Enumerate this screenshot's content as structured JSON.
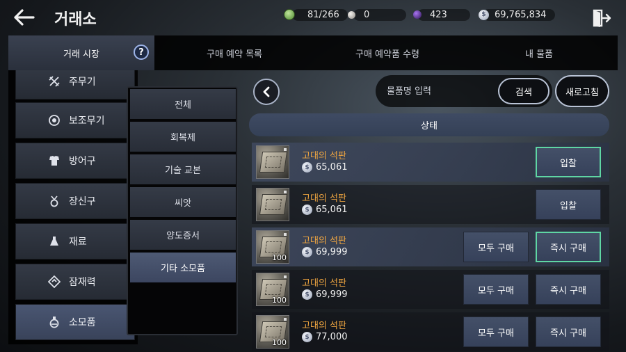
{
  "header": {
    "title": "거래소",
    "resources": [
      {
        "icon": "green-gem-icon",
        "value": "81/266",
        "color": "#7bb85a"
      },
      {
        "icon": "silver-pearl-icon",
        "value": "0",
        "color": "#c9c6c2"
      },
      {
        "icon": "purple-orb-icon",
        "value": "423",
        "color": "#6a3fb0"
      },
      {
        "icon": "silver-coin-icon",
        "value": "69,765,834",
        "color": "#b8c1d4"
      }
    ]
  },
  "tabs": [
    {
      "label": "거래 시장",
      "active": true
    },
    {
      "label": "구매 예약 목록",
      "active": false
    },
    {
      "label": "구매 예약품 수령",
      "active": false
    },
    {
      "label": "내 물품",
      "active": false
    }
  ],
  "categories": [
    {
      "label": "주무기",
      "icon": "crossed-swords-icon"
    },
    {
      "label": "보조무기",
      "icon": "ring-target-icon"
    },
    {
      "label": "방어구",
      "icon": "armor-icon"
    },
    {
      "label": "장신구",
      "icon": "necklace-icon"
    },
    {
      "label": "재료",
      "icon": "flask-icon"
    },
    {
      "label": "잠재력",
      "icon": "diamond-rune-icon"
    },
    {
      "label": "소모품",
      "icon": "potion-icon",
      "active": true
    }
  ],
  "subcategories": [
    {
      "label": "전체"
    },
    {
      "label": "회복제"
    },
    {
      "label": "기술 교본"
    },
    {
      "label": "씨앗"
    },
    {
      "label": "양도증서"
    },
    {
      "label": "기타 소모품",
      "active": true
    }
  ],
  "search": {
    "placeholder": "물품명 입력",
    "button": "검색",
    "refresh": "새로고침"
  },
  "list": {
    "header": "상태",
    "rows": [
      {
        "name": "고대의 석판",
        "price": "65,061",
        "qty": "",
        "buttons": [
          {
            "label": "입찰",
            "highlight": true
          }
        ]
      },
      {
        "name": "고대의 석판",
        "price": "65,061",
        "qty": "",
        "buttons": [
          {
            "label": "입찰",
            "highlight": false
          }
        ]
      },
      {
        "name": "고대의 석판",
        "price": "69,999",
        "qty": "100",
        "buttons": [
          {
            "label": "모두 구매",
            "highlight": false
          },
          {
            "label": "즉시 구매",
            "highlight": true
          }
        ]
      },
      {
        "name": "고대의 석판",
        "price": "69,999",
        "qty": "100",
        "buttons": [
          {
            "label": "모두 구매",
            "highlight": false
          },
          {
            "label": "즉시 구매",
            "highlight": false
          }
        ]
      },
      {
        "name": "고대의 석판",
        "price": "77,000",
        "qty": "100",
        "buttons": [
          {
            "label": "모두 구매",
            "highlight": false
          },
          {
            "label": "즉시 구매",
            "highlight": false
          }
        ]
      }
    ]
  },
  "colors": {
    "accent_green": "#5fd6a4",
    "item_name": "#f0a640",
    "panel": "#000000"
  }
}
